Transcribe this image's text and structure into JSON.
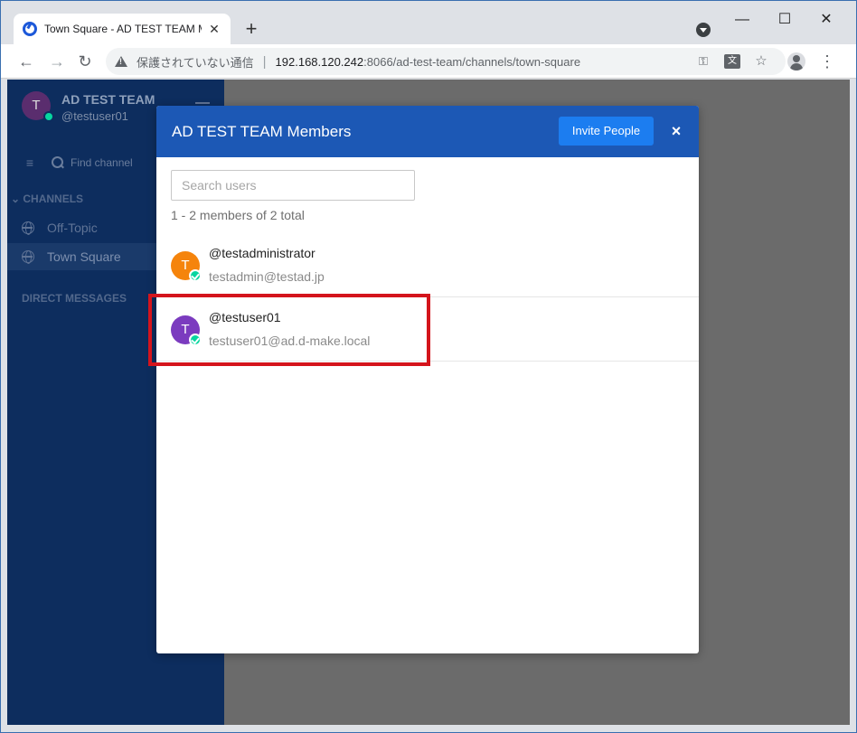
{
  "browser": {
    "tab_title": "Town Square - AD TEST TEAM M",
    "tab_close": "✕",
    "new_tab": "+",
    "security_label": "保護されていない通信",
    "url_host": "192.168.120.242",
    "url_path": ":8066/ad-test-team/channels/town-square",
    "window_controls": {
      "minimize": "—",
      "maximize": "☐",
      "close": "✕"
    },
    "icons": [
      "back-icon",
      "forward-icon",
      "reload-icon",
      "warning-icon",
      "key-icon",
      "translate-icon",
      "star-icon",
      "profile-icon",
      "menu-icon"
    ]
  },
  "sidebar": {
    "team_avatar": "T",
    "team_name": "AD TEST TEAM",
    "username": "@testuser01",
    "find_channel": "Find channel",
    "channels_header": "CHANNELS",
    "channels": [
      {
        "label": "Off-Topic"
      },
      {
        "label": "Town Square"
      }
    ],
    "direct_messages_header": "DIRECT MESSAGES"
  },
  "modal": {
    "title": "AD TEST TEAM Members",
    "invite_label": "Invite People",
    "close_label": "×",
    "search_placeholder": "Search users",
    "member_count": "1 - 2 members of 2 total",
    "members": [
      {
        "initial": "T",
        "username": "@testadministrator",
        "email": "testadmin@testad.jp",
        "avatar_color": "#f5840c"
      },
      {
        "initial": "T",
        "username": "@testuser01",
        "email": "testuser01@ad.d-make.local",
        "avatar_color": "#7b3bbf"
      }
    ]
  },
  "colors": {
    "modal_header": "#1c58b5",
    "invite_button": "#1c7df0",
    "sidebar": "#0d2d5e",
    "online_status": "#06d6a0",
    "highlight": "#d4141c"
  }
}
